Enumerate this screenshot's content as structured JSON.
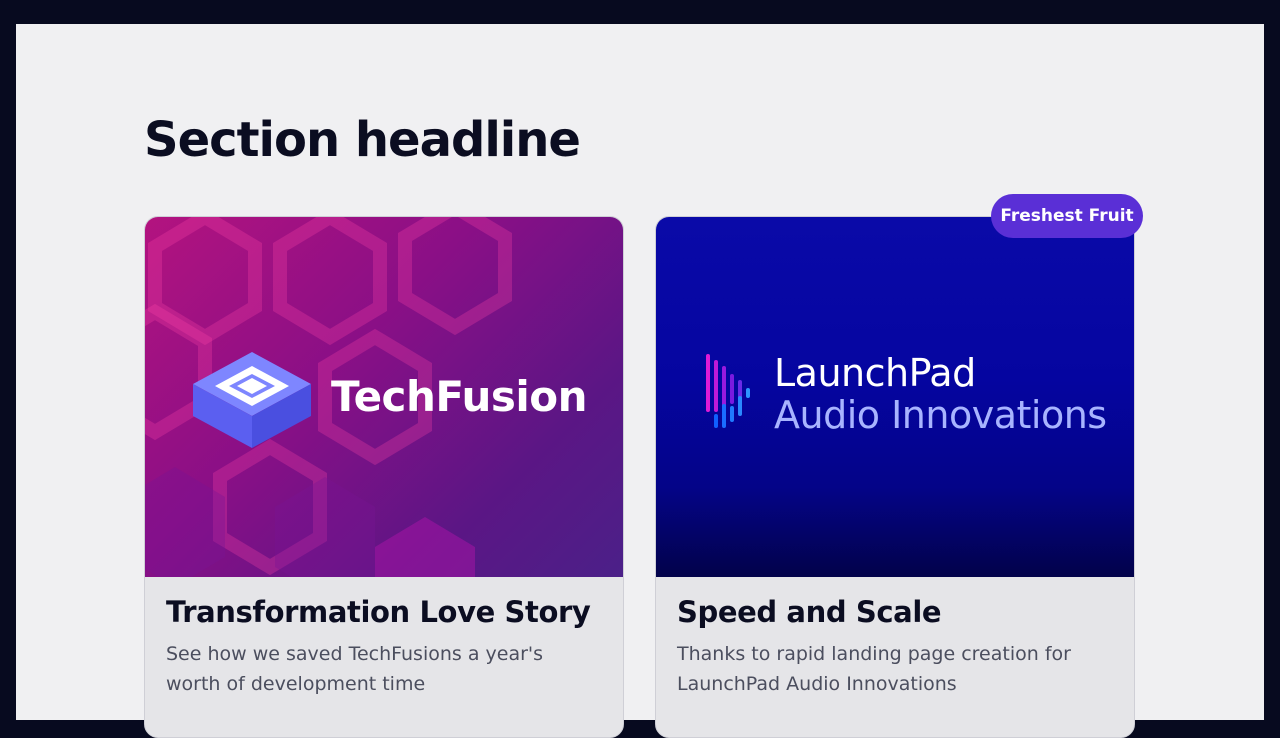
{
  "section": {
    "headline": "Section headline"
  },
  "cards": [
    {
      "brand": "TechFusion",
      "title": "Transformation Love Story",
      "description": "See how we saved TechFusions a year's worth of development time",
      "logo_icon": "layered-stack-icon"
    },
    {
      "badge": "Freshest Fruit",
      "brand_line1": "LaunchPad",
      "brand_line2": "Audio Innovations",
      "title": "Speed and Scale",
      "description": "Thanks to rapid landing page creation for LaunchPad Audio Innovations",
      "logo_icon": "audio-waveform-icon"
    }
  ],
  "colors": {
    "page_background": "#070a1f",
    "panel_background": "#f0f0f2",
    "badge_background": "#5a2fd6",
    "techfusion_gradient_start": "#b3137f",
    "techfusion_gradient_end": "#4b2088",
    "launchpad_background": "#0505a0"
  }
}
